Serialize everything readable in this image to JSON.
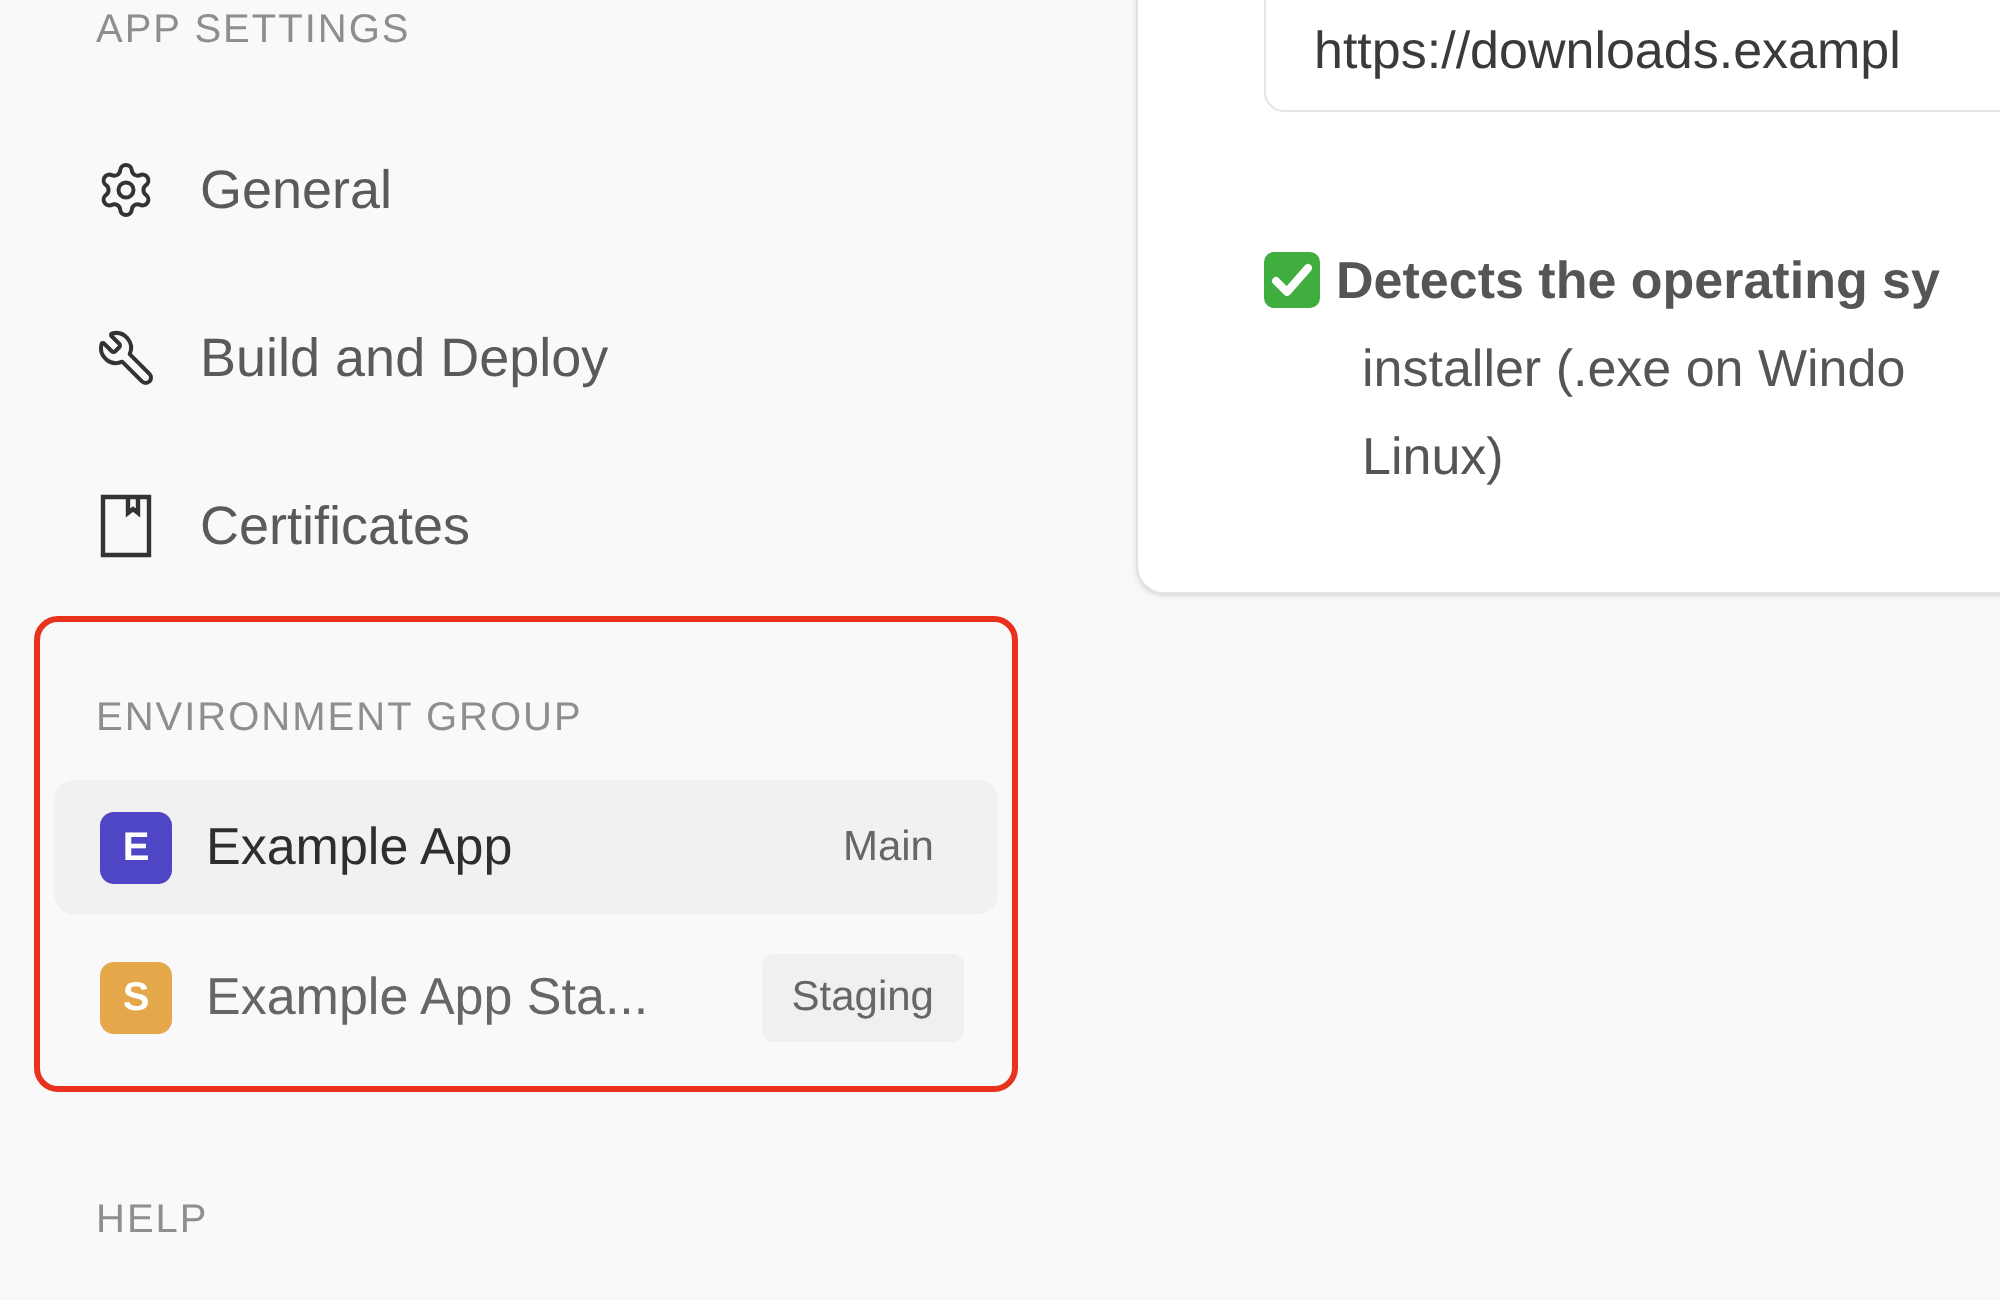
{
  "app_settings": {
    "heading": "APP SETTINGS",
    "items": [
      {
        "label": "General"
      },
      {
        "label": "Build and Deploy"
      },
      {
        "label": "Certificates"
      }
    ]
  },
  "environment_group": {
    "heading": "ENVIRONMENT GROUP",
    "highlighted": true,
    "items": [
      {
        "initial": "E",
        "name": "Example App",
        "badge": "Main",
        "color": "#4f46c5",
        "selected": true
      },
      {
        "initial": "S",
        "name": "Example App Sta...",
        "badge": "Staging",
        "color": "#e4a84a",
        "selected": false
      }
    ]
  },
  "help": {
    "heading": "HELP"
  },
  "card": {
    "url_field": {
      "value": "https://downloads.exampl"
    },
    "feature": {
      "title": "Detects the operating sy",
      "lines": [
        "installer (.exe on Windo",
        "Linux)"
      ]
    }
  }
}
